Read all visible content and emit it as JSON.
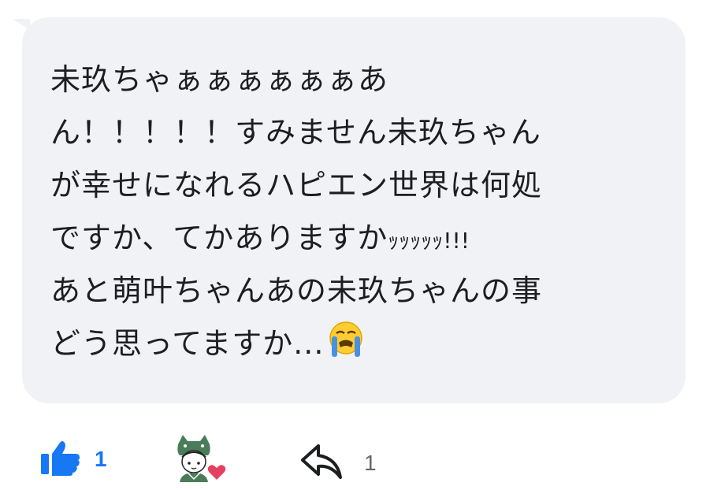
{
  "comment": {
    "lines": [
      "未玖ちゃぁぁぁぁぁぁあ",
      "ん！！！！！すみません未玖ちゃん",
      "が幸せになれるハピエン世界は何処",
      "ですか、てかありますか",
      "あと萌叶ちゃんあの未玖ちゃんの事",
      "どう思ってますか..."
    ],
    "line4_suffix": "ｯｯｯｯｯ!!!",
    "emoji": "loudly-crying-face-icon"
  },
  "actions": {
    "like_count": "1",
    "reply_count": "1",
    "reaction": "heart"
  },
  "colors": {
    "bubble": "#f0f2f5",
    "text": "#1c1e21",
    "like": "#1877f2",
    "muted": "#65676b",
    "heart": "#e4405f"
  }
}
